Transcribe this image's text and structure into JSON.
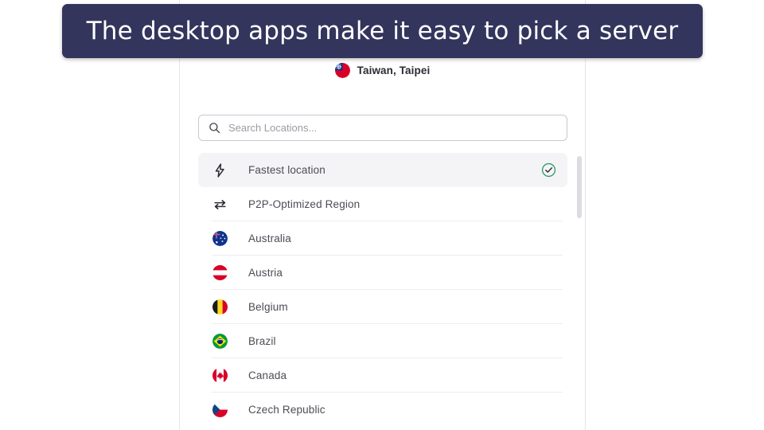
{
  "banner": {
    "text": "The desktop apps make it easy to pick a server",
    "background": "#33355c",
    "text_color": "#ffffff"
  },
  "panel": {
    "current_location": {
      "flag": "taiwan-flag-icon",
      "label": "Taiwan, Taipei"
    },
    "search": {
      "icon": "search-icon",
      "placeholder": "Search Locations...",
      "value": ""
    },
    "list": [
      {
        "id": "fastest-location",
        "label": "Fastest location",
        "icon": "lightning-bolt-icon",
        "selected": true,
        "check": "check-circle-icon",
        "check_color": "#2e9e63",
        "divider": false
      },
      {
        "id": "p2p-optimized-region",
        "label": "P2P-Optimized Region",
        "icon": "exchange-arrows-icon",
        "selected": false,
        "divider": true
      },
      {
        "id": "australia",
        "label": "Australia",
        "icon": "australia-flag-icon",
        "selected": false,
        "divider": true
      },
      {
        "id": "austria",
        "label": "Austria",
        "icon": "austria-flag-icon",
        "selected": false,
        "divider": true
      },
      {
        "id": "belgium",
        "label": "Belgium",
        "icon": "belgium-flag-icon",
        "selected": false,
        "divider": true
      },
      {
        "id": "brazil",
        "label": "Brazil",
        "icon": "brazil-flag-icon",
        "selected": false,
        "divider": true
      },
      {
        "id": "canada",
        "label": "Canada",
        "icon": "canada-flag-icon",
        "selected": false,
        "divider": true
      },
      {
        "id": "czech-republic",
        "label": "Czech Republic",
        "icon": "czech-republic-flag-icon",
        "selected": false,
        "divider": false
      }
    ],
    "scrollbar": {
      "thumb_color": "#dcdce2"
    }
  }
}
